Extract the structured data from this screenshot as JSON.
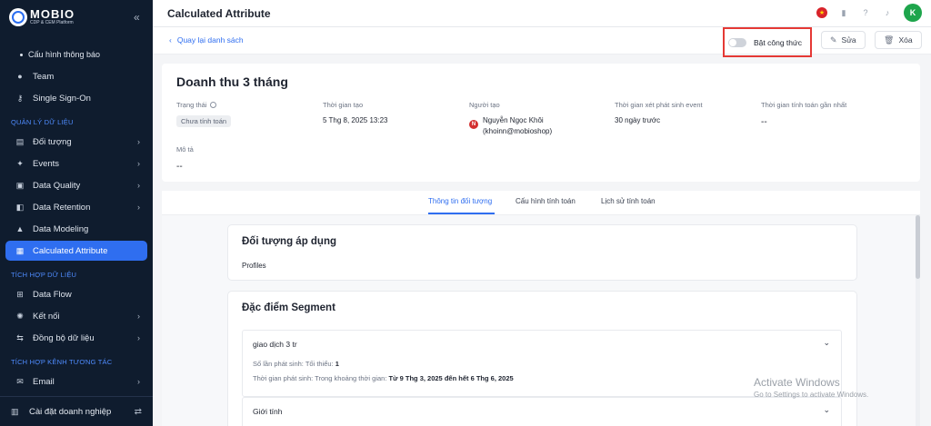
{
  "app": {
    "logo_name": "MOBIO",
    "logo_sub": "CDP & CEM Platform",
    "page_title": "Calculated Attribute"
  },
  "sidebar": {
    "sub_item": "Cấu hình thông báo",
    "items_top": [
      {
        "label": "Team",
        "icon": "team-icon"
      },
      {
        "label": "Single Sign-On",
        "icon": "key-icon"
      }
    ],
    "section_data": "QUẢN LÝ DỮ LIỆU",
    "items_data": [
      {
        "label": "Đối tượng",
        "icon": "table-icon",
        "chevron": true
      },
      {
        "label": "Events",
        "icon": "events-icon",
        "chevron": true
      },
      {
        "label": "Data Quality",
        "icon": "quality-icon",
        "chevron": true
      },
      {
        "label": "Data Retention",
        "icon": "retention-icon",
        "chevron": true
      },
      {
        "label": "Data Modeling",
        "icon": "modeling-icon",
        "chevron": false
      },
      {
        "label": "Calculated Attribute",
        "icon": "calculator-icon",
        "chevron": false,
        "active": true
      }
    ],
    "section_integration": "TÍCH HỢP DỮ LIỆU",
    "items_integration": [
      {
        "label": "Data Flow",
        "icon": "dataflow-icon",
        "chevron": false
      },
      {
        "label": "Kết nối",
        "icon": "connect-icon",
        "chevron": true
      },
      {
        "label": "Đồng bộ dữ liệu",
        "icon": "sync-icon",
        "chevron": true
      }
    ],
    "section_channels": "TÍCH HỢP KÊNH TƯƠNG TÁC",
    "items_channels": [
      {
        "label": "Email",
        "icon": "email-icon",
        "chevron": true
      }
    ],
    "bottom_label": "Cài đặt doanh nghiệp"
  },
  "header": {
    "avatar_initial": "K"
  },
  "subheader": {
    "back_label": "Quay lại danh sách",
    "toggle_label": "Bật công thức",
    "toggle_on": false,
    "edit_label": "Sửa",
    "delete_label": "Xóa"
  },
  "info": {
    "title": "Doanh thu 3 tháng",
    "status_label": "Trạng thái",
    "status_value": "Chưa tính toán",
    "created_time_label": "Thời gian tạo",
    "created_time_value": "5 Thg 8, 2025 13:23",
    "creator_label": "Người tạo",
    "creator_initial": "N",
    "creator_name": "Nguyễn Ngọc Khôi",
    "creator_email": "(khoinn@mobioshop)",
    "event_window_label": "Thời gian xét phát sinh event",
    "event_window_value": "30 ngày trước",
    "last_calc_label": "Thời gian tính toán gần nhất",
    "last_calc_value": "--",
    "desc_label": "Mô tả",
    "desc_value": "--"
  },
  "tabs": [
    {
      "label": "Thông tin đối tượng",
      "active": true
    },
    {
      "label": "Cấu hình tính toán",
      "active": false
    },
    {
      "label": "Lịch sử tính toán",
      "active": false
    }
  ],
  "applied_object": {
    "title": "Đối tượng áp dụng",
    "value": "Profiles"
  },
  "segment": {
    "title": "Đặc điểm Segment",
    "items": [
      {
        "name": "giao dịch 3 tr",
        "line1_label": "Số lần phát sinh: Tối thiểu:",
        "line1_value": "1",
        "line2_label": "Thời gian phát sinh: Trong khoảng thời gian:",
        "line2_value": "Từ 9 Thg 3, 2025 đến hết 6 Thg 6, 2025"
      },
      {
        "name": "Giới tính"
      }
    ]
  },
  "watermark": {
    "title": "Activate Windows",
    "subtitle": "Go to Settings to activate Windows."
  },
  "colors": {
    "sidebar_bg": "#0f1c2e",
    "accent": "#2f6ef0",
    "highlight_border": "#e53935"
  }
}
